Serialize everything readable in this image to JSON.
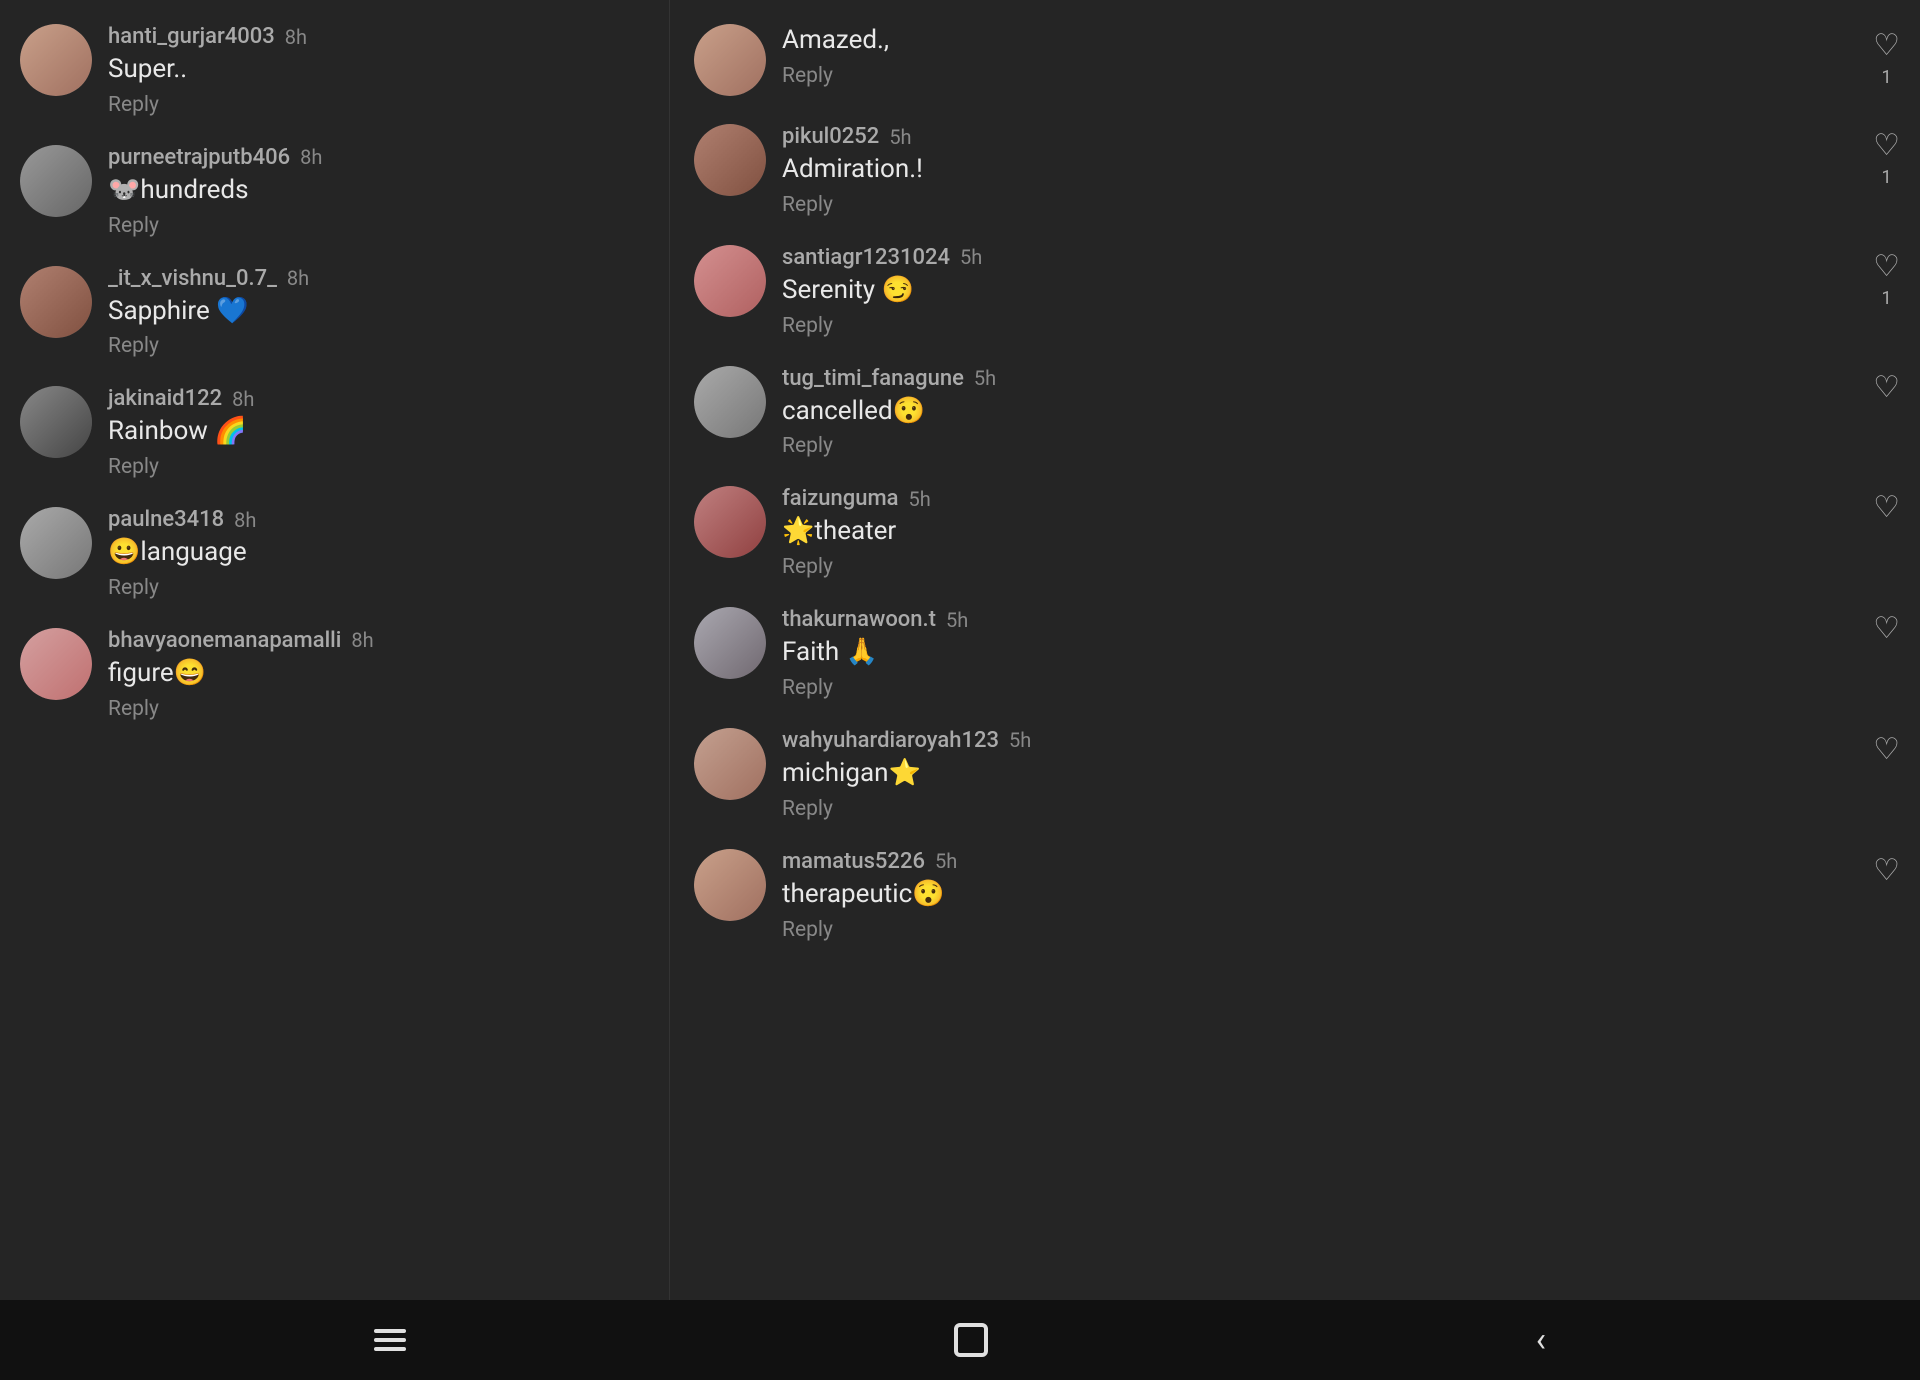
{
  "left_panel": {
    "comments": [
      {
        "id": "c1",
        "username": "hanti_gurjar4003",
        "time": "8h",
        "text": "Super..",
        "reply_label": "Reply",
        "avatar_class": "avatar-1"
      },
      {
        "id": "c2",
        "username": "purneetrajputb406",
        "time": "8h",
        "text": "🐭hundreds",
        "reply_label": "Reply",
        "avatar_class": "avatar-2"
      },
      {
        "id": "c3",
        "username": "_it_x_vishnu_0.7_",
        "time": "8h",
        "text": "Sapphire 💙",
        "reply_label": "Reply",
        "avatar_class": "avatar-3"
      },
      {
        "id": "c4",
        "username": "jakinaid122",
        "time": "8h",
        "text": "Rainbow 🌈",
        "reply_label": "Reply",
        "avatar_class": "avatar-4"
      },
      {
        "id": "c5",
        "username": "paulne3418",
        "time": "8h",
        "text": "😀language",
        "reply_label": "Reply",
        "avatar_class": "avatar-5"
      },
      {
        "id": "c6",
        "username": "bhavyaonemanapamalli",
        "time": "8h",
        "text": "figure😄",
        "reply_label": "Reply",
        "avatar_class": "avatar-6"
      }
    ]
  },
  "right_panel": {
    "comments": [
      {
        "id": "r0",
        "username": "",
        "time": "",
        "text": "Amazed.,",
        "reply_label": "Reply",
        "avatar_class": "avatar-r1",
        "has_like": true,
        "like_count": "1",
        "show_header": false
      },
      {
        "id": "r1",
        "username": "pikul0252",
        "time": "5h",
        "text": "Admiration.!",
        "reply_label": "Reply",
        "avatar_class": "avatar-r2",
        "has_like": true,
        "like_count": "1",
        "show_header": true
      },
      {
        "id": "r2",
        "username": "santiagr1231024",
        "time": "5h",
        "text": "Serenity 😏",
        "reply_label": "Reply",
        "avatar_class": "avatar-r3",
        "has_like": true,
        "like_count": "1",
        "show_header": true
      },
      {
        "id": "r3",
        "username": "tug_timi_fanagune",
        "time": "5h",
        "text": "cancelled😯",
        "reply_label": "Reply",
        "avatar_class": "avatar-r4",
        "has_like": true,
        "like_count": "",
        "show_header": true
      },
      {
        "id": "r4",
        "username": "faizunguma",
        "time": "5h",
        "text": "🌟theater",
        "reply_label": "Reply",
        "avatar_class": "avatar-r5",
        "has_like": true,
        "like_count": "",
        "show_header": true
      },
      {
        "id": "r5",
        "username": "thakurnawoon.t",
        "time": "5h",
        "text": "Faith 🙏",
        "reply_label": "Reply",
        "avatar_class": "avatar-r6",
        "has_like": true,
        "like_count": "",
        "show_header": true
      },
      {
        "id": "r6",
        "username": "wahyuhardiaroyah123",
        "time": "5h",
        "text": "michigan⭐",
        "reply_label": "Reply",
        "avatar_class": "avatar-r7",
        "has_like": true,
        "like_count": "",
        "show_header": true
      },
      {
        "id": "r7",
        "username": "mamatus5226",
        "time": "5h",
        "text": "therapeutic😯",
        "reply_label": "Reply",
        "avatar_class": "avatar-r1",
        "has_like": true,
        "like_count": "",
        "show_header": true
      }
    ]
  },
  "nav": {
    "recents_label": "recents",
    "home_label": "home",
    "back_label": "back"
  }
}
